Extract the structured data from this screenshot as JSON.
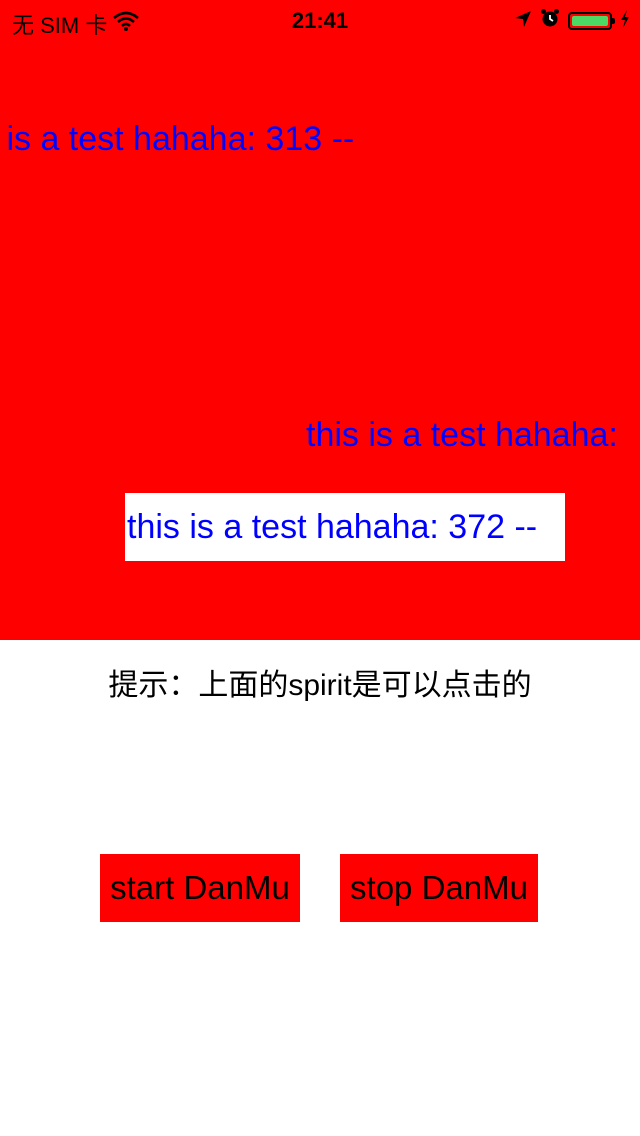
{
  "status_bar": {
    "carrier": "无 SIM 卡",
    "time": "21:41",
    "icons": [
      "wifi-icon",
      "location-arrow-icon",
      "alarm-clock-icon",
      "battery-icon",
      "charging-bolt-icon"
    ],
    "battery_color": "#4cd964"
  },
  "danmu": {
    "background_color": "#ff0000",
    "text_color": "#0000ff",
    "sprites": [
      "s is a test hahaha: 313 --",
      "--",
      "this is a test hahaha: ",
      "this is a test hahaha: 372 --"
    ]
  },
  "hint": "提示：上面的spirit是可以点击的",
  "buttons": {
    "start_label": "start DanMu",
    "stop_label": "stop DanMu",
    "color": "#ff0000"
  }
}
